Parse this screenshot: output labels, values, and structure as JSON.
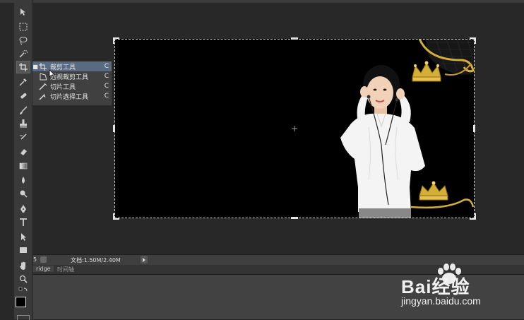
{
  "app": "Photoshop",
  "flyout": {
    "items": [
      {
        "label": "裁剪工具",
        "shortcut": "C",
        "icon": "crop-icon",
        "selected": true
      },
      {
        "label": "透视裁剪工具",
        "shortcut": "C",
        "icon": "perspective-crop-icon",
        "selected": false
      },
      {
        "label": "切片工具",
        "shortcut": "C",
        "icon": "slice-icon",
        "selected": false
      },
      {
        "label": "切片选择工具",
        "shortcut": "C",
        "icon": "slice-select-icon",
        "selected": false
      }
    ]
  },
  "status": {
    "zoom_fragment": "5",
    "doc_info": "文档:1.50M/2.40M"
  },
  "tabs": [
    {
      "label": "ridge"
    },
    {
      "label": "时间轴"
    }
  ],
  "watermark": {
    "brand": "Bai经验",
    "url": "jingyan.baidu.com"
  },
  "colors": {
    "selection": "#5a6a80",
    "gold": "#d4af37"
  }
}
